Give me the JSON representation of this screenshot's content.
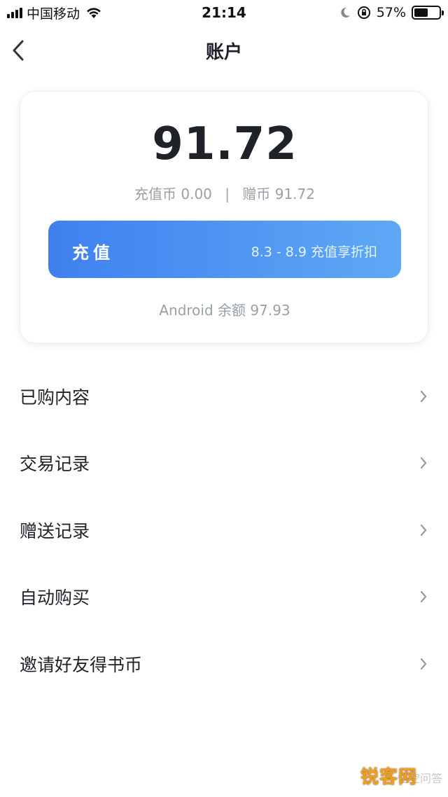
{
  "status_bar": {
    "carrier": "中国移动",
    "time": "21:14",
    "battery_percent": "57%",
    "battery_level": 0.57,
    "icons": [
      "signal-icon",
      "wifi-icon",
      "moon-icon",
      "rotation-lock-icon",
      "battery-icon"
    ]
  },
  "nav": {
    "title": "账户",
    "back_icon": "chevron-left-icon"
  },
  "account": {
    "balance": "91.72",
    "recharge_coin_label": "充值币",
    "recharge_coin_value": "0.00",
    "separator": "|",
    "bonus_coin_label": "赠币",
    "bonus_coin_value": "91.72",
    "recharge_button_label": "充值",
    "recharge_promo": "8.3 - 8.9 充值享折扣",
    "android_balance": "Android 余额 97.93"
  },
  "menu": {
    "items": [
      {
        "label": "已购内容"
      },
      {
        "label": "交易记录"
      },
      {
        "label": "赠送记录"
      },
      {
        "label": "自动购买"
      },
      {
        "label": "邀请好友得书币"
      }
    ],
    "chevron_icon": "chevron-right-icon"
  },
  "watermark": {
    "text": "锐客网",
    "faint_text": "悟空问答"
  },
  "colors": {
    "accent_start": "#3f80ef",
    "accent_end": "#5ea9f5",
    "text_primary": "#1f2329",
    "text_secondary": "#9aa0a8"
  }
}
